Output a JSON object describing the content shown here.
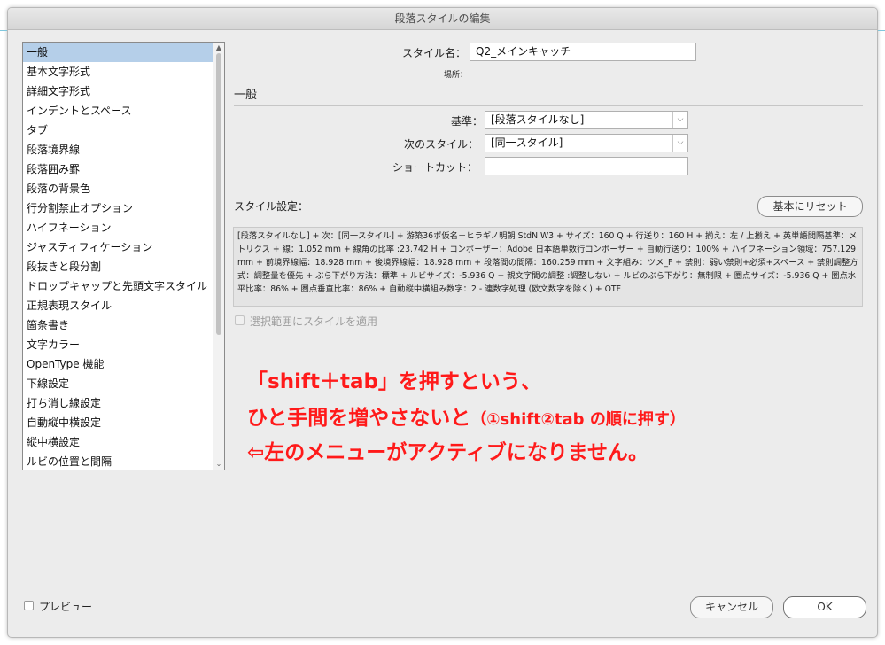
{
  "window": {
    "title": "段落スタイルの編集"
  },
  "sidebar": {
    "items": [
      {
        "label": "一般",
        "selected": true
      },
      {
        "label": "基本文字形式"
      },
      {
        "label": "詳細文字形式"
      },
      {
        "label": "インデントとスペース"
      },
      {
        "label": "タブ"
      },
      {
        "label": "段落境界線"
      },
      {
        "label": "段落囲み罫"
      },
      {
        "label": "段落の背景色"
      },
      {
        "label": "行分割禁止オプション"
      },
      {
        "label": "ハイフネーション"
      },
      {
        "label": "ジャスティフィケーション"
      },
      {
        "label": "段抜きと段分割"
      },
      {
        "label": "ドロップキャップと先頭文字スタイル"
      },
      {
        "label": "正規表現スタイル"
      },
      {
        "label": "箇条書き"
      },
      {
        "label": "文字カラー"
      },
      {
        "label": "OpenType 機能"
      },
      {
        "label": "下線設定"
      },
      {
        "label": "打ち消し線設定"
      },
      {
        "label": "自動縦中横設定"
      },
      {
        "label": "縦中横設定"
      },
      {
        "label": "ルビの位置と間隔"
      }
    ]
  },
  "form": {
    "style_name_label": "スタイル名：",
    "style_name_value": "Q2_メインキャッチ",
    "location_label": "場所：",
    "section_title": "一般",
    "based_on_label": "基準：",
    "based_on_value": "[段落スタイルなし]",
    "next_style_label": "次のスタイル：",
    "next_style_value": "[同一スタイル]",
    "shortcut_label": "ショートカット：",
    "shortcut_value": "",
    "style_settings_label": "スタイル設定：",
    "reset_button": "基本にリセット",
    "summary_text": "[段落スタイルなし] + 次：[同一スタイル] + 游築36ポ仮名＋ヒラギノ明朝 StdN W3 + サイズ：160 Q + 行送り：160 H + 揃え：左 / 上揃え + 英単語間隔基準：メトリクス + 線：1.052 mm + 線角の比率 :23.742 H + コンポーザー：Adobe 日本語単数行コンポーザー + 自動行送り：100% + ハイフネーション領域：757.129 mm + 前境界線幅：18.928 mm + 後境界線幅：18.928 mm + 段落間の間隔：160.259 mm + 文字組み：ツメ_F + 禁則：弱い禁則+必須+スペース + 禁則調整方式：調整量を優先 + ぶら下がり方法：標準 + ルビサイズ：-5.936 Q + 親文字間の調整 :調整しない + ルビのぶら下がり：無制限 + 圏点サイズ：-5.936 Q + 圏点水平比率：86% + 圏点垂直比率：86% + 自動縦中横組み数字：2 - 連数字処理 (欧文数字を除く) + OTF",
    "apply_selection_label": "選択範囲にスタイルを適用"
  },
  "annotation": {
    "line1": "「shift＋tab」を押すという、",
    "line2_main": "ひと手間を増やさないと",
    "line2_note": "（①shift②tab の順に押す）",
    "line3": "⇦左のメニューがアクティブになりません。"
  },
  "footer": {
    "preview_label": "プレビュー",
    "cancel_button": "キャンセル",
    "ok_button": "OK"
  },
  "colors": {
    "annotation_red": "#ff1a1a",
    "selection_blue": "#b5cfe9",
    "window_bg": "#ececec"
  }
}
